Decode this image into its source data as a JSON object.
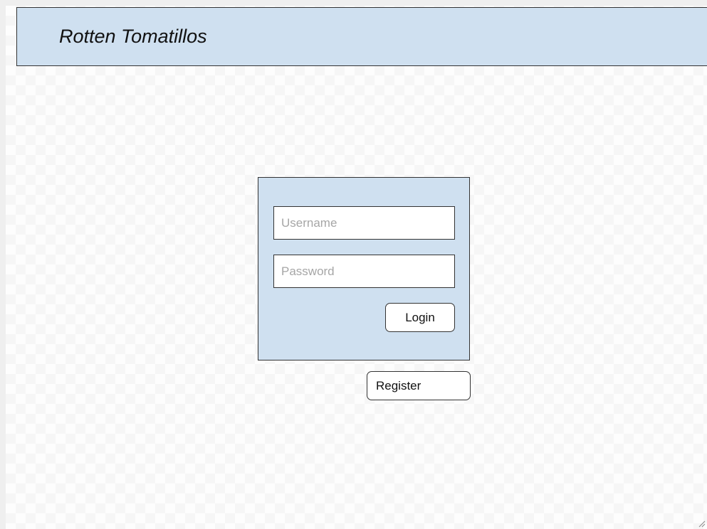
{
  "header": {
    "title": "Rotten Tomatillos"
  },
  "login_form": {
    "username_placeholder": "Username",
    "password_placeholder": "Password",
    "login_label": "Login"
  },
  "register": {
    "label": "Register"
  },
  "colors": {
    "panel_fill": "#cfe0f0",
    "border": "#333333"
  }
}
